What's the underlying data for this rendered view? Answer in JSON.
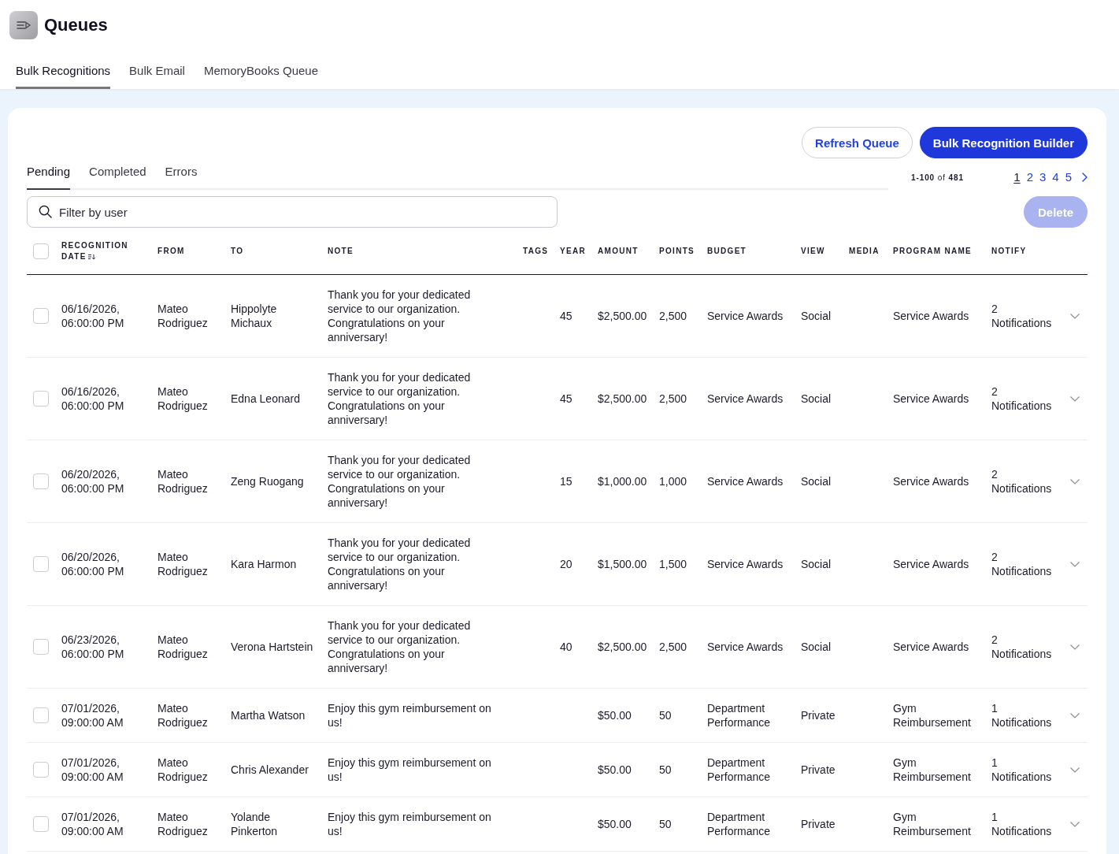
{
  "header": {
    "title": "Queues"
  },
  "tabs": [
    {
      "label": "Bulk Recognitions",
      "selected": true
    },
    {
      "label": "Bulk Email",
      "selected": false
    },
    {
      "label": "MemoryBooks Queue",
      "selected": false
    }
  ],
  "actions": [
    {
      "label": "Refresh Queue",
      "kind": "secondary"
    },
    {
      "label": "Bulk Recognition Builder",
      "kind": "primary"
    }
  ],
  "subtabs": [
    {
      "label": "Pending",
      "selected": true
    },
    {
      "label": "Completed",
      "selected": false
    },
    {
      "label": "Errors",
      "selected": false
    }
  ],
  "pagination": {
    "summary": "**1-100** of **481**",
    "pages": [
      {
        "label": "1",
        "selected": true
      },
      {
        "label": "2",
        "selected": false
      },
      {
        "label": "3",
        "selected": false
      },
      {
        "label": "4",
        "selected": false
      },
      {
        "label": "5",
        "selected": false
      }
    ]
  },
  "filter": {
    "placeholder": "Filter by user"
  },
  "delete_button": {
    "label": "Delete",
    "disabled": true
  },
  "table": {
    "select_all": {
      "checked": false
    },
    "columns": [
      {
        "label": "RECOGNITION DATE",
        "sorted": true
      },
      {
        "label": "FROM",
        "sorted": false
      },
      {
        "label": "TO",
        "sorted": false
      },
      {
        "label": "NOTE",
        "sorted": false
      },
      {
        "label": "TAGS",
        "sorted": false
      },
      {
        "label": "YEAR",
        "sorted": false
      },
      {
        "label": "AMOUNT",
        "sorted": false
      },
      {
        "label": "POINTS",
        "sorted": false
      },
      {
        "label": "BUDGET",
        "sorted": false
      },
      {
        "label": "VIEW",
        "sorted": false
      },
      {
        "label": "MEDIA",
        "sorted": false
      },
      {
        "label": "PROGRAM NAME",
        "sorted": false
      },
      {
        "label": "NOTIFY",
        "sorted": false
      }
    ],
    "rows": [
      {
        "checked": false,
        "expanded": false,
        "date": "06/16/2026, 06:00:00 PM",
        "from": "Mateo Rodriguez",
        "to": "Hippolyte Michaux",
        "note": "Thank you for your dedicated service to our organization. Congratulations on your anniversary!",
        "year": "45",
        "amount": "$2,500.00",
        "points": "2,500",
        "budget": "Service Awards",
        "view": "Social",
        "program_name": "Service Awards",
        "notify": "2 Notifications"
      },
      {
        "checked": false,
        "expanded": false,
        "date": "06/16/2026, 06:00:00 PM",
        "from": "Mateo Rodriguez",
        "to": "Edna Leonard",
        "note": "Thank you for your dedicated service to our organization. Congratulations on your anniversary!",
        "year": "45",
        "amount": "$2,500.00",
        "points": "2,500",
        "budget": "Service Awards",
        "view": "Social",
        "program_name": "Service Awards",
        "notify": "2 Notifications"
      },
      {
        "checked": false,
        "expanded": false,
        "date": "06/20/2026, 06:00:00 PM",
        "from": "Mateo Rodriguez",
        "to": "Zeng Ruogang",
        "note": "Thank you for your dedicated service to our organization. Congratulations on your anniversary!",
        "year": "15",
        "amount": "$1,000.00",
        "points": "1,000",
        "budget": "Service Awards",
        "view": "Social",
        "program_name": "Service Awards",
        "notify": "2 Notifications"
      },
      {
        "checked": false,
        "expanded": false,
        "date": "06/20/2026, 06:00:00 PM",
        "from": "Mateo Rodriguez",
        "to": "Kara Harmon",
        "note": "Thank you for your dedicated service to our organization. Congratulations on your anniversary!",
        "year": "20",
        "amount": "$1,500.00",
        "points": "1,500",
        "budget": "Service Awards",
        "view": "Social",
        "program_name": "Service Awards",
        "notify": "2 Notifications"
      },
      {
        "checked": false,
        "expanded": false,
        "date": "06/23/2026, 06:00:00 PM",
        "from": "Mateo Rodriguez",
        "to": "Verona Hartstein",
        "note": "Thank you for your dedicated service to our organization. Congratulations on your anniversary!",
        "year": "40",
        "amount": "$2,500.00",
        "points": "2,500",
        "budget": "Service Awards",
        "view": "Social",
        "program_name": "Service Awards",
        "notify": "2 Notifications"
      },
      {
        "checked": false,
        "expanded": false,
        "date": "07/01/2026, 09:00:00 AM",
        "from": "Mateo Rodriguez",
        "to": "Martha Watson",
        "note": "Enjoy this gym reimbursement on us!",
        "amount": "$50.00",
        "points": "50",
        "budget": "Department Performance",
        "view": "Private",
        "program_name": "Gym Reimbursement",
        "notify": "1 Notifications"
      },
      {
        "checked": false,
        "expanded": false,
        "date": "07/01/2026, 09:00:00 AM",
        "from": "Mateo Rodriguez",
        "to": "Chris Alexander",
        "note": "Enjoy this gym reimbursement on us!",
        "amount": "$50.00",
        "points": "50",
        "budget": "Department Performance",
        "view": "Private",
        "program_name": "Gym Reimbursement",
        "notify": "1 Notifications"
      },
      {
        "checked": false,
        "expanded": false,
        "date": "07/01/2026, 09:00:00 AM",
        "from": "Mateo Rodriguez",
        "to": "Yolande Pinkerton",
        "note": "Enjoy this gym reimbursement on us!",
        "amount": "$50.00",
        "points": "50",
        "budget": "Department Performance",
        "view": "Private",
        "program_name": "Gym Reimbursement",
        "notify": "1 Notifications"
      }
    ]
  }
}
